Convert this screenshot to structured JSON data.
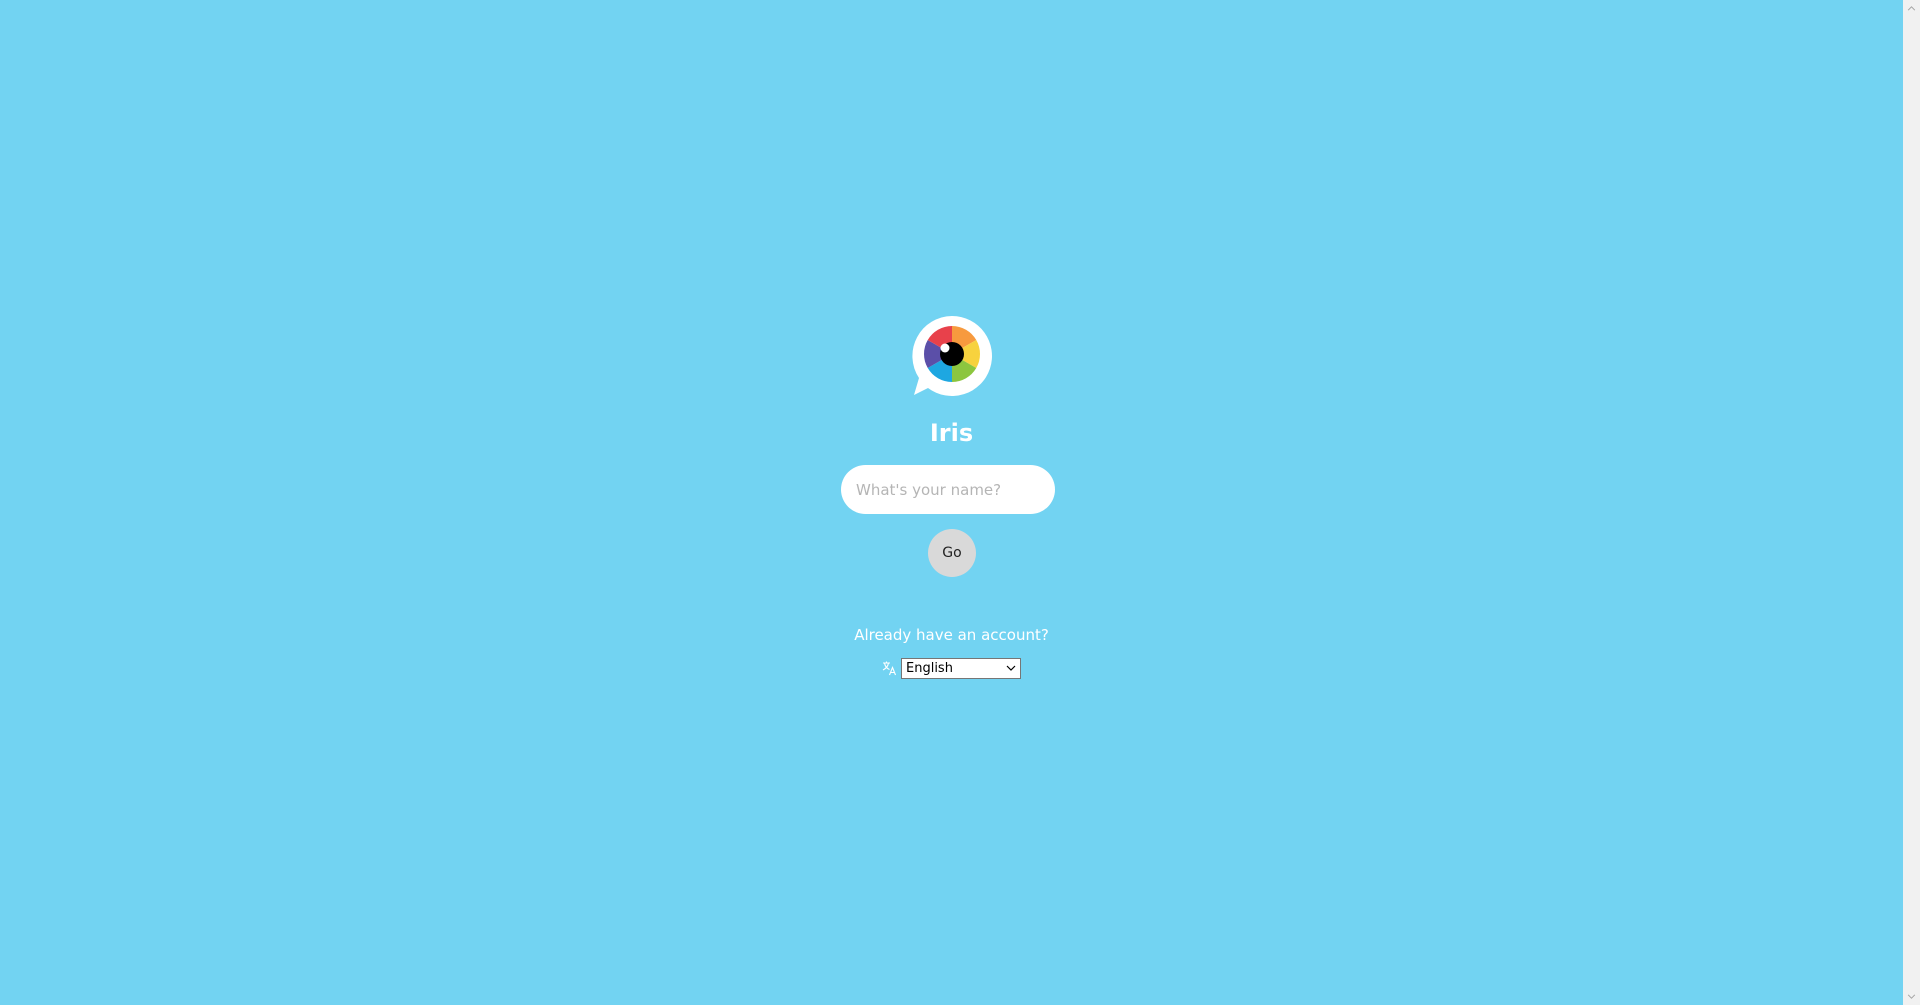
{
  "app": {
    "title": "Iris"
  },
  "signup": {
    "name_placeholder": "What's your name?",
    "name_value": "",
    "go_label": "Go"
  },
  "login": {
    "link_text": "Already have an account?"
  },
  "language": {
    "icon": "translate-icon",
    "selected": "English"
  },
  "colors": {
    "background": "#72d3f2",
    "button": "#d9d9d9",
    "text": "#ffffff"
  }
}
